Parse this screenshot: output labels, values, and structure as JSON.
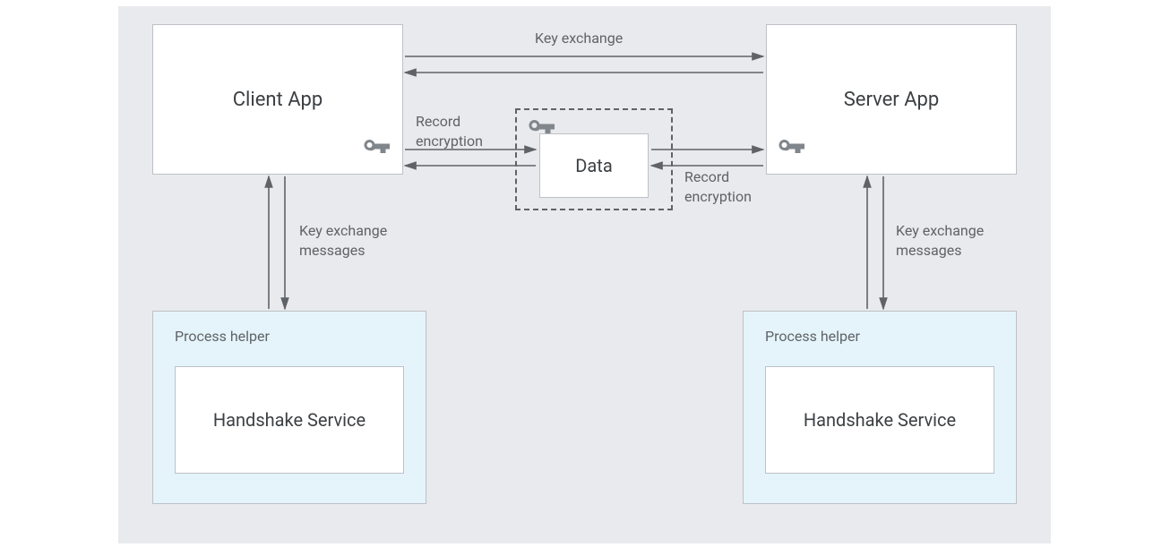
{
  "boxes": {
    "client_app": "Client App",
    "server_app": "Server App",
    "data": "Data",
    "handshake_service": "Handshake Service"
  },
  "labels": {
    "process_helper": "Process helper",
    "key_exchange": "Key exchange",
    "key_exchange_messages": "Key exchange\nmessages",
    "record_encryption": "Record\nencryption"
  },
  "colors": {
    "canvas_bg": "#e8eaed",
    "box_bg": "#ffffff",
    "box_border": "#bdc1c6",
    "helper_bg": "#e5f4fb",
    "text": "#3c4043",
    "muted": "#5f6368",
    "arrow": "#5f6368",
    "icon": "#80868b"
  }
}
